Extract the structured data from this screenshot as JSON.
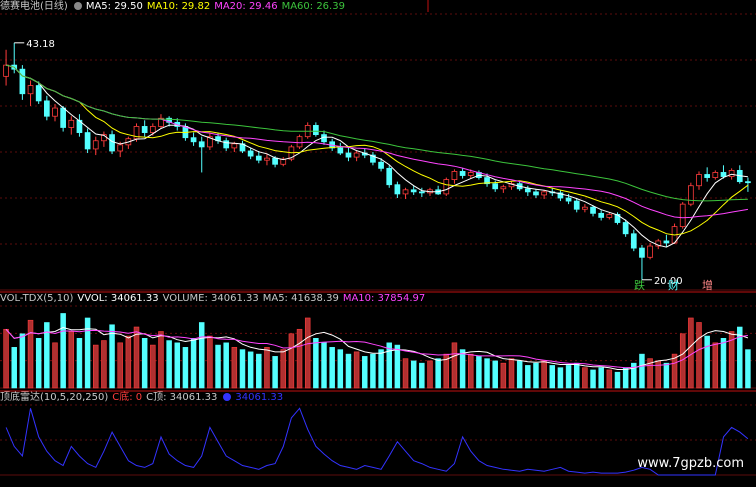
{
  "price_panel": {
    "title": "德赛电池(日线)",
    "ma5": "MA5: 29.50",
    "ma10": "MA10: 29.82",
    "ma20": "MA20: 29.46",
    "ma60": "MA60: 26.39",
    "high_label": "43.18",
    "low_label": "20.00",
    "markers": [
      "跌",
      "财",
      "增"
    ]
  },
  "volume_panel": {
    "title": "VOL-TDX(5,10)",
    "vvol": "VVOL: 34061.33",
    "volume": "VOLUME: 34061.33",
    "ma5": "MA5: 41638.39",
    "ma10": "MA10: 37854.97"
  },
  "radar_panel": {
    "title": "顶底雷达(10,5,20,250)",
    "c_bottom": "C底: 0",
    "c_top": "C顶: 34061.33",
    "value": "34061.33"
  },
  "watermark": "www.7gpzb.com",
  "colors": {
    "up": "#ff3c3c",
    "down": "#54ffff",
    "ma5": "#ffffff",
    "ma10": "#ffff00",
    "ma20": "#ff44ff",
    "ma60": "#3cc43c",
    "grid": "#7a1010",
    "radar": "#3333ff"
  },
  "chart_data": {
    "type": "candlestick",
    "price_range": [
      19,
      46
    ],
    "ohlc": [
      [
        39.9,
        42.5,
        39.0,
        41.0
      ],
      [
        41.0,
        43.18,
        40.2,
        40.6
      ],
      [
        40.6,
        41.0,
        37.6,
        38.2
      ],
      [
        38.2,
        39.5,
        37.0,
        39.0
      ],
      [
        39.0,
        39.4,
        37.2,
        37.5
      ],
      [
        37.5,
        38.0,
        35.6,
        36.0
      ],
      [
        36.0,
        37.2,
        35.5,
        36.8
      ],
      [
        36.8,
        37.0,
        34.5,
        34.9
      ],
      [
        34.9,
        36.0,
        34.2,
        35.6
      ],
      [
        35.6,
        36.2,
        34.0,
        34.4
      ],
      [
        34.4,
        34.8,
        32.4,
        32.8
      ],
      [
        32.8,
        34.0,
        32.2,
        33.6
      ],
      [
        33.6,
        34.5,
        33.0,
        34.2
      ],
      [
        34.2,
        34.6,
        32.3,
        32.6
      ],
      [
        32.6,
        33.5,
        32.0,
        33.2
      ],
      [
        33.2,
        34.0,
        32.8,
        33.8
      ],
      [
        33.8,
        35.3,
        33.5,
        35.0
      ],
      [
        35.0,
        35.6,
        34.0,
        34.4
      ],
      [
        34.4,
        35.3,
        34.1,
        35.0
      ],
      [
        35.0,
        36.2,
        34.8,
        35.8
      ],
      [
        35.8,
        36.0,
        35.0,
        35.4
      ],
      [
        35.4,
        35.8,
        34.6,
        35.0
      ],
      [
        35.0,
        35.3,
        33.6,
        33.9
      ],
      [
        33.9,
        34.4,
        33.1,
        33.5
      ],
      [
        33.5,
        34.0,
        30.5,
        33.0
      ],
      [
        33.0,
        34.3,
        32.7,
        34.0
      ],
      [
        34.0,
        34.4,
        33.3,
        33.6
      ],
      [
        33.6,
        33.9,
        32.6,
        32.9
      ],
      [
        32.9,
        33.5,
        32.5,
        33.3
      ],
      [
        33.3,
        33.6,
        32.4,
        32.6
      ],
      [
        32.6,
        32.9,
        31.8,
        32.1
      ],
      [
        32.1,
        32.6,
        31.4,
        31.7
      ],
      [
        31.7,
        32.3,
        31.2,
        31.9
      ],
      [
        31.9,
        32.1,
        31.0,
        31.3
      ],
      [
        31.3,
        32.0,
        31.1,
        31.8
      ],
      [
        31.8,
        33.2,
        31.6,
        33.0
      ],
      [
        33.0,
        34.2,
        32.8,
        34.0
      ],
      [
        34.0,
        35.4,
        33.8,
        35.1
      ],
      [
        35.1,
        35.4,
        34.0,
        34.2
      ],
      [
        34.2,
        34.6,
        33.2,
        33.5
      ],
      [
        33.5,
        33.8,
        32.6,
        32.9
      ],
      [
        32.9,
        33.4,
        32.2,
        32.4
      ],
      [
        32.4,
        32.9,
        31.6,
        32.0
      ],
      [
        32.0,
        32.6,
        31.6,
        32.4
      ],
      [
        32.4,
        32.8,
        31.9,
        32.2
      ],
      [
        32.2,
        32.5,
        31.2,
        31.5
      ],
      [
        31.5,
        31.9,
        30.6,
        30.9
      ],
      [
        30.9,
        31.2,
        29.0,
        29.3
      ],
      [
        29.3,
        29.6,
        28.0,
        28.4
      ],
      [
        28.4,
        29.0,
        27.9,
        28.8
      ],
      [
        28.8,
        29.2,
        28.3,
        28.6
      ],
      [
        28.6,
        29.0,
        28.1,
        28.5
      ],
      [
        28.5,
        29.0,
        28.2,
        28.8
      ],
      [
        28.8,
        29.2,
        28.3,
        28.4
      ],
      [
        28.4,
        30.0,
        28.2,
        29.8
      ],
      [
        29.8,
        30.8,
        29.4,
        30.6
      ],
      [
        30.6,
        30.9,
        29.9,
        30.2
      ],
      [
        30.2,
        30.8,
        29.9,
        30.5
      ],
      [
        30.5,
        30.7,
        29.8,
        30.0
      ],
      [
        30.0,
        30.4,
        29.1,
        29.4
      ],
      [
        29.4,
        29.7,
        28.6,
        28.9
      ],
      [
        28.9,
        29.3,
        28.5,
        29.1
      ],
      [
        29.1,
        29.6,
        28.8,
        29.4
      ],
      [
        29.4,
        29.6,
        28.7,
        28.9
      ],
      [
        28.9,
        29.2,
        28.2,
        28.6
      ],
      [
        28.6,
        28.9,
        28.0,
        28.3
      ],
      [
        28.3,
        28.8,
        27.9,
        28.6
      ],
      [
        28.6,
        29.0,
        28.2,
        28.5
      ],
      [
        28.5,
        28.8,
        27.7,
        28.0
      ],
      [
        28.0,
        28.4,
        27.4,
        27.7
      ],
      [
        27.7,
        28.0,
        26.6,
        26.9
      ],
      [
        26.9,
        27.4,
        26.6,
        27.1
      ],
      [
        27.1,
        27.3,
        26.2,
        26.5
      ],
      [
        26.5,
        26.8,
        25.8,
        26.1
      ],
      [
        26.1,
        26.6,
        25.9,
        26.4
      ],
      [
        26.4,
        26.6,
        25.4,
        25.6
      ],
      [
        25.6,
        25.9,
        24.2,
        24.5
      ],
      [
        24.5,
        24.9,
        22.8,
        23.1
      ],
      [
        23.1,
        23.4,
        20.0,
        22.2
      ],
      [
        22.2,
        23.6,
        22.0,
        23.3
      ],
      [
        23.3,
        24.0,
        23.0,
        23.8
      ],
      [
        23.8,
        24.4,
        23.2,
        23.6
      ],
      [
        23.6,
        25.5,
        23.5,
        25.2
      ],
      [
        25.2,
        27.6,
        25.0,
        27.4
      ],
      [
        27.4,
        29.5,
        27.2,
        29.2
      ],
      [
        29.2,
        30.6,
        28.8,
        30.3
      ],
      [
        30.3,
        31.0,
        29.6,
        30.0
      ],
      [
        30.0,
        30.7,
        29.8,
        30.5
      ],
      [
        30.5,
        31.2,
        29.9,
        30.1
      ],
      [
        30.1,
        30.9,
        29.8,
        30.7
      ],
      [
        30.7,
        31.2,
        29.4,
        29.6
      ],
      [
        29.6,
        30.0,
        28.6,
        29.5
      ]
    ],
    "volume": [
      52,
      36,
      48,
      60,
      44,
      58,
      40,
      66,
      50,
      44,
      62,
      38,
      42,
      56,
      40,
      46,
      54,
      44,
      38,
      50,
      42,
      40,
      36,
      44,
      58,
      46,
      38,
      40,
      36,
      34,
      32,
      30,
      36,
      28,
      34,
      48,
      52,
      62,
      44,
      40,
      36,
      34,
      30,
      32,
      28,
      30,
      34,
      40,
      38,
      26,
      24,
      22,
      24,
      26,
      30,
      40,
      34,
      30,
      28,
      26,
      24,
      22,
      26,
      24,
      20,
      22,
      24,
      20,
      18,
      20,
      22,
      18,
      16,
      18,
      16,
      14,
      18,
      22,
      30,
      26,
      24,
      22,
      30,
      48,
      62,
      58,
      46,
      40,
      44,
      50,
      54,
      34
    ],
    "radar": [
      50,
      30,
      20,
      70,
      40,
      25,
      15,
      10,
      30,
      20,
      12,
      8,
      25,
      45,
      30,
      15,
      10,
      8,
      12,
      40,
      22,
      15,
      10,
      8,
      20,
      50,
      35,
      20,
      15,
      10,
      8,
      6,
      10,
      12,
      30,
      60,
      70,
      48,
      30,
      22,
      15,
      10,
      8,
      6,
      10,
      8,
      6,
      20,
      35,
      25,
      15,
      12,
      8,
      6,
      4,
      12,
      40,
      25,
      15,
      10,
      8,
      6,
      5,
      4,
      6,
      5,
      4,
      6,
      8,
      4,
      3,
      2,
      3,
      2,
      2,
      2,
      3,
      5,
      8,
      6,
      0,
      0,
      0,
      0,
      0,
      0,
      0,
      0,
      40,
      50,
      45,
      38
    ]
  }
}
